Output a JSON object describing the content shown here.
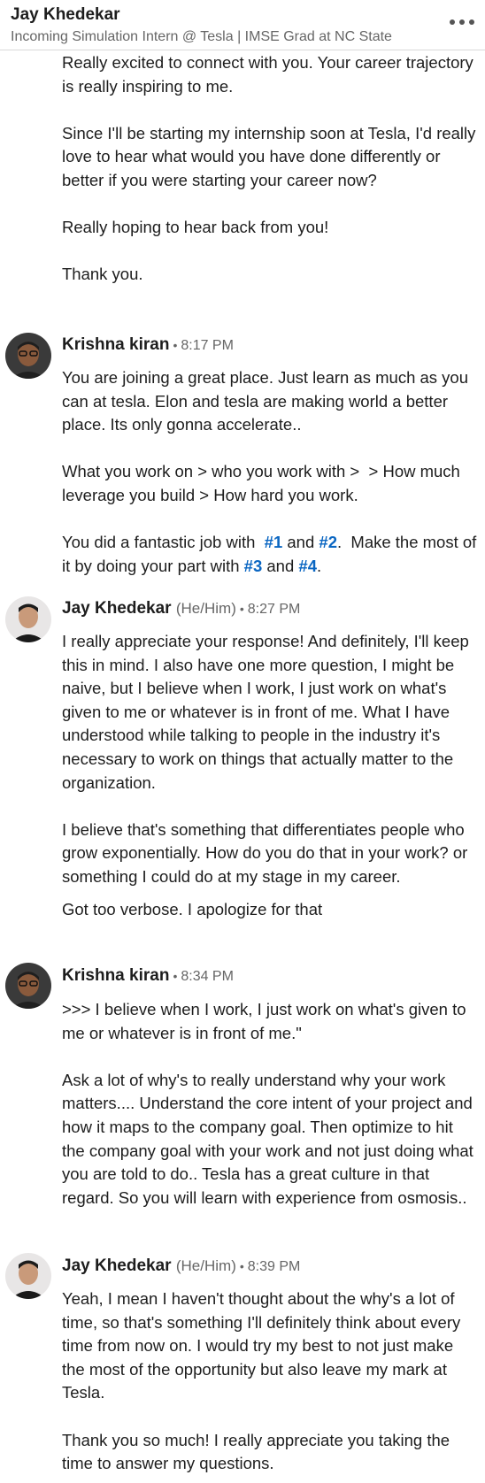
{
  "header": {
    "name": "Jay Khedekar",
    "headline": "Incoming Simulation Intern @ Tesla | IMSE Grad at NC State"
  },
  "intro": [
    "Really excited to connect with you. Your career trajectory is really inspiring to me.",
    "Since I'll be starting my internship soon at Tesla, I'd really love to hear what would you have done differently or better if you were starting your career now?",
    "Really hoping to hear back from you!",
    "Thank you."
  ],
  "m1": {
    "sender": "Krishna kiran",
    "time": "8:17 PM",
    "p1": "You are joining a great place. Just learn as much as you can at tesla. Elon and tesla are making world a better place. Its only gonna accelerate..",
    "p2": "What you work on > who you work with >  > How much leverage you build > How hard you work.",
    "p3": {
      "a": "You did a fantastic job with  ",
      "t1": "#1",
      "b": " and ",
      "t2": "#2",
      "c": ".  Make the most of it by doing your part with ",
      "t3": "#3",
      "d": " and ",
      "t4": "#4",
      "e": "."
    }
  },
  "m2": {
    "sender": "Jay Khedekar",
    "pronoun": "(He/Him)",
    "time": "8:27 PM",
    "p1": "I really appreciate your response! And definitely, I'll keep this in mind. I also have one more question, I might be naive, but I believe when I work, I just work on what's given to me or whatever is in front of me. What I have understood while talking to people in the industry it's necessary to work on things that actually matter to the organization.",
    "p2": "I believe that's something that differentiates people who grow exponentially. How do you do that in your work? or something I could do at my stage in my career.",
    "p3": "Got too verbose. I apologize for that"
  },
  "m3": {
    "sender": "Krishna kiran",
    "time": "8:34 PM",
    "p1": ">>> I believe when I work, I just work on what's given to me or whatever is in front of me.\"",
    "p2": "Ask a lot of why's to really understand why your work matters.... Understand the core intent of your project and how it maps to the company goal. Then optimize to hit the company goal with your work and not just doing what you are told to do.. Tesla has a great culture in that regard. So you will learn with experience from osmosis.."
  },
  "m4": {
    "sender": "Jay Khedekar",
    "pronoun": "(He/Him)",
    "time": "8:39 PM",
    "p1": "Yeah, I mean I haven't thought about the why's a lot of time, so that's something I'll definitely think about every time from now on. I would try my best to not just make the most of the opportunity but also leave my mark at Tesla.",
    "p2": "Thank you so much! I really appreciate you taking the time to answer my questions."
  },
  "colors": {
    "hashtag": "#0a66c2",
    "text": "#1d1d1d",
    "muted": "#666666"
  }
}
